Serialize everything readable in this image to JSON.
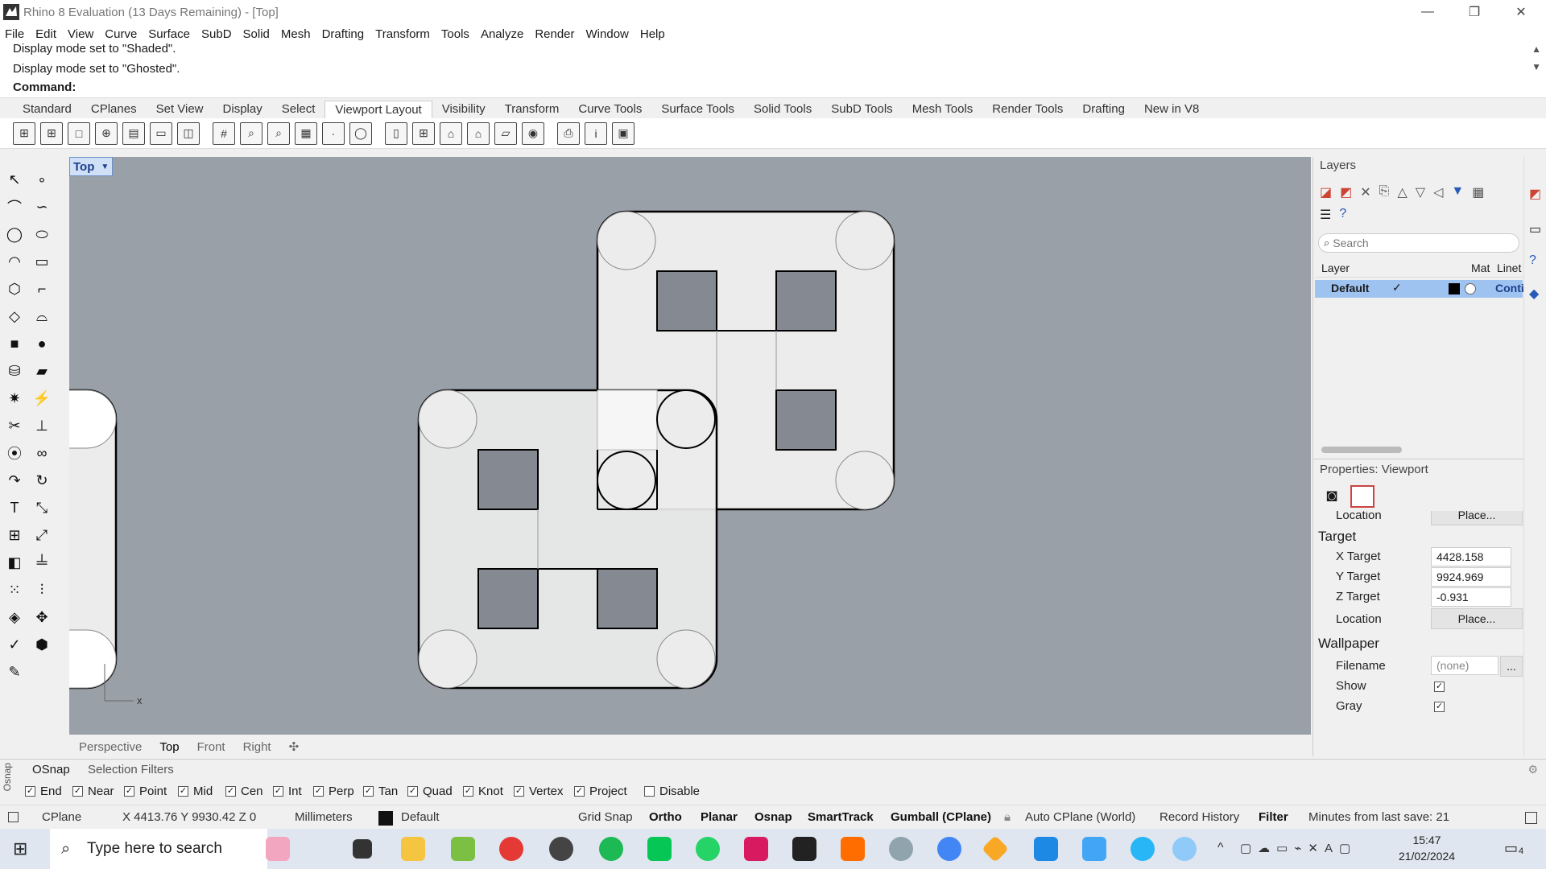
{
  "window": {
    "title": "Rhino 8 Evaluation (13 Days Remaining) - [Top]"
  },
  "menu": [
    "File",
    "Edit",
    "View",
    "Curve",
    "Surface",
    "SubD",
    "Solid",
    "Mesh",
    "Drafting",
    "Transform",
    "Tools",
    "Analyze",
    "Render",
    "Window",
    "Help"
  ],
  "command": {
    "history": [
      "Display mode set to \"Shaded\".",
      "Display mode set to \"Ghosted\"."
    ],
    "prompt": "Command:"
  },
  "toolbar_tabs": [
    "Standard",
    "CPlanes",
    "Set View",
    "Display",
    "Select",
    "Viewport Layout",
    "Visibility",
    "Transform",
    "Curve Tools",
    "Surface Tools",
    "Solid Tools",
    "SubD Tools",
    "Mesh Tools",
    "Render Tools",
    "Drafting",
    "New in V8"
  ],
  "active_toolbar_tab": "Viewport Layout",
  "viewport": {
    "name": "Top",
    "axis_label": "x"
  },
  "viewport_tabs": [
    "Perspective",
    "Top",
    "Front",
    "Right"
  ],
  "layers": {
    "title": "Layers",
    "search_placeholder": "Search",
    "columns": [
      "Layer",
      "Mat",
      "Linet"
    ],
    "rows": [
      {
        "name": "Default",
        "linetype": "Conti"
      }
    ]
  },
  "properties": {
    "title": "Properties: Viewport",
    "partial_row": {
      "label": "Location",
      "button": "Place..."
    },
    "target_section": "Target",
    "x_target": {
      "label": "X Target",
      "value": "4428.158"
    },
    "y_target": {
      "label": "Y Target",
      "value": "9924.969"
    },
    "z_target": {
      "label": "Z Target",
      "value": "-0.931"
    },
    "location": {
      "label": "Location",
      "button": "Place..."
    },
    "wallpaper_section": "Wallpaper",
    "filename": {
      "label": "Filename",
      "value": "(none)",
      "browse": "..."
    },
    "show": {
      "label": "Show",
      "checked": true
    },
    "gray": {
      "label": "Gray",
      "checked": true
    }
  },
  "osnap": {
    "tabs": [
      "OSnap",
      "Selection Filters"
    ],
    "side_label": "Osnap",
    "items": [
      "End",
      "Near",
      "Point",
      "Mid",
      "Cen",
      "Int",
      "Perp",
      "Tan",
      "Quad",
      "Knot",
      "Vertex",
      "Project"
    ],
    "disable": "Disable"
  },
  "status": {
    "cplane": "CPlane",
    "coords": "X 4413.76 Y 9930.42 Z 0",
    "units": "Millimeters",
    "layer": "Default",
    "grid_snap": "Grid Snap",
    "ortho": "Ortho",
    "planar": "Planar",
    "osnap": "Osnap",
    "smarttrack": "SmartTrack",
    "gumball": "Gumball (CPlane)",
    "auto_cplane": "Auto CPlane (World)",
    "record_history": "Record History",
    "filter": "Filter",
    "minutes": "Minutes from last save: 21"
  },
  "taskbar": {
    "search_placeholder": "Type here to search",
    "time": "15:47",
    "date": "21/02/2024",
    "notification_count": "4"
  },
  "colors": {
    "viewport_bg": "#9aa0a8",
    "shape_fill": "#ececec",
    "hole_fill": "#858a92",
    "accent": "#3c78d8"
  }
}
